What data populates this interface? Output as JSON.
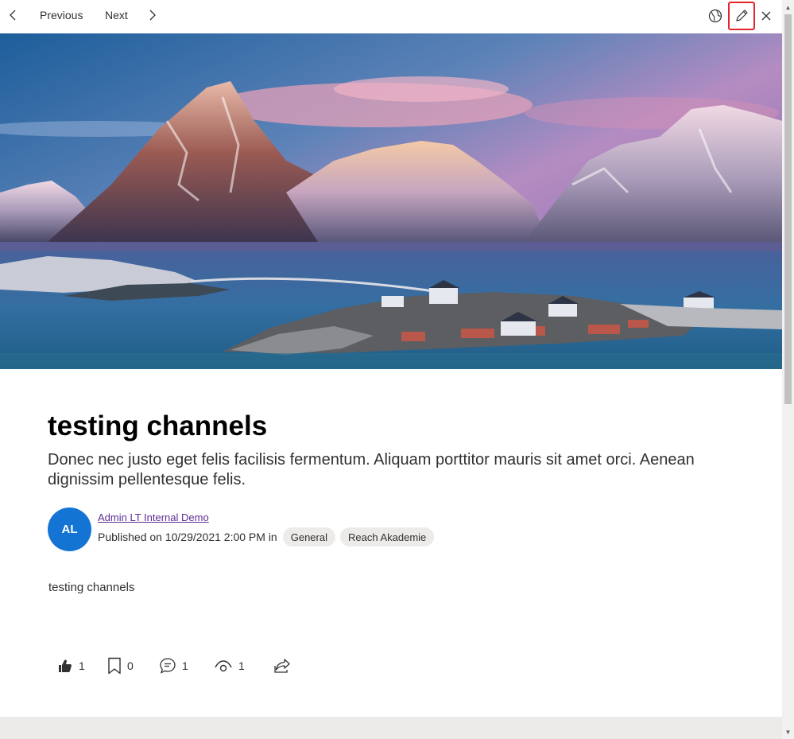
{
  "nav": {
    "previous_label": "Previous",
    "next_label": "Next",
    "icons": [
      "chevron-left-icon",
      "chevron-right-icon",
      "globe-icon",
      "edit-icon",
      "close-icon"
    ]
  },
  "article": {
    "title": "testing channels",
    "subtitle": "Donec nec justo eget felis facilisis fermentum. Aliquam porttitor mauris sit amet orci. Aenean dignissim pellentesque felis.",
    "author_initials": "AL",
    "author_name": "Admin LT Internal Demo",
    "published_text": "Published on 10/29/2021 2:00 PM in",
    "channels": [
      "General",
      "Reach Akademie"
    ],
    "body": "testing channels"
  },
  "actions": {
    "likes": "1",
    "bookmarks": "0",
    "comments": "1",
    "views": "1"
  },
  "colors": {
    "accent": "#1474d4",
    "highlight": "#e3242b",
    "link": "#5c2d91"
  }
}
